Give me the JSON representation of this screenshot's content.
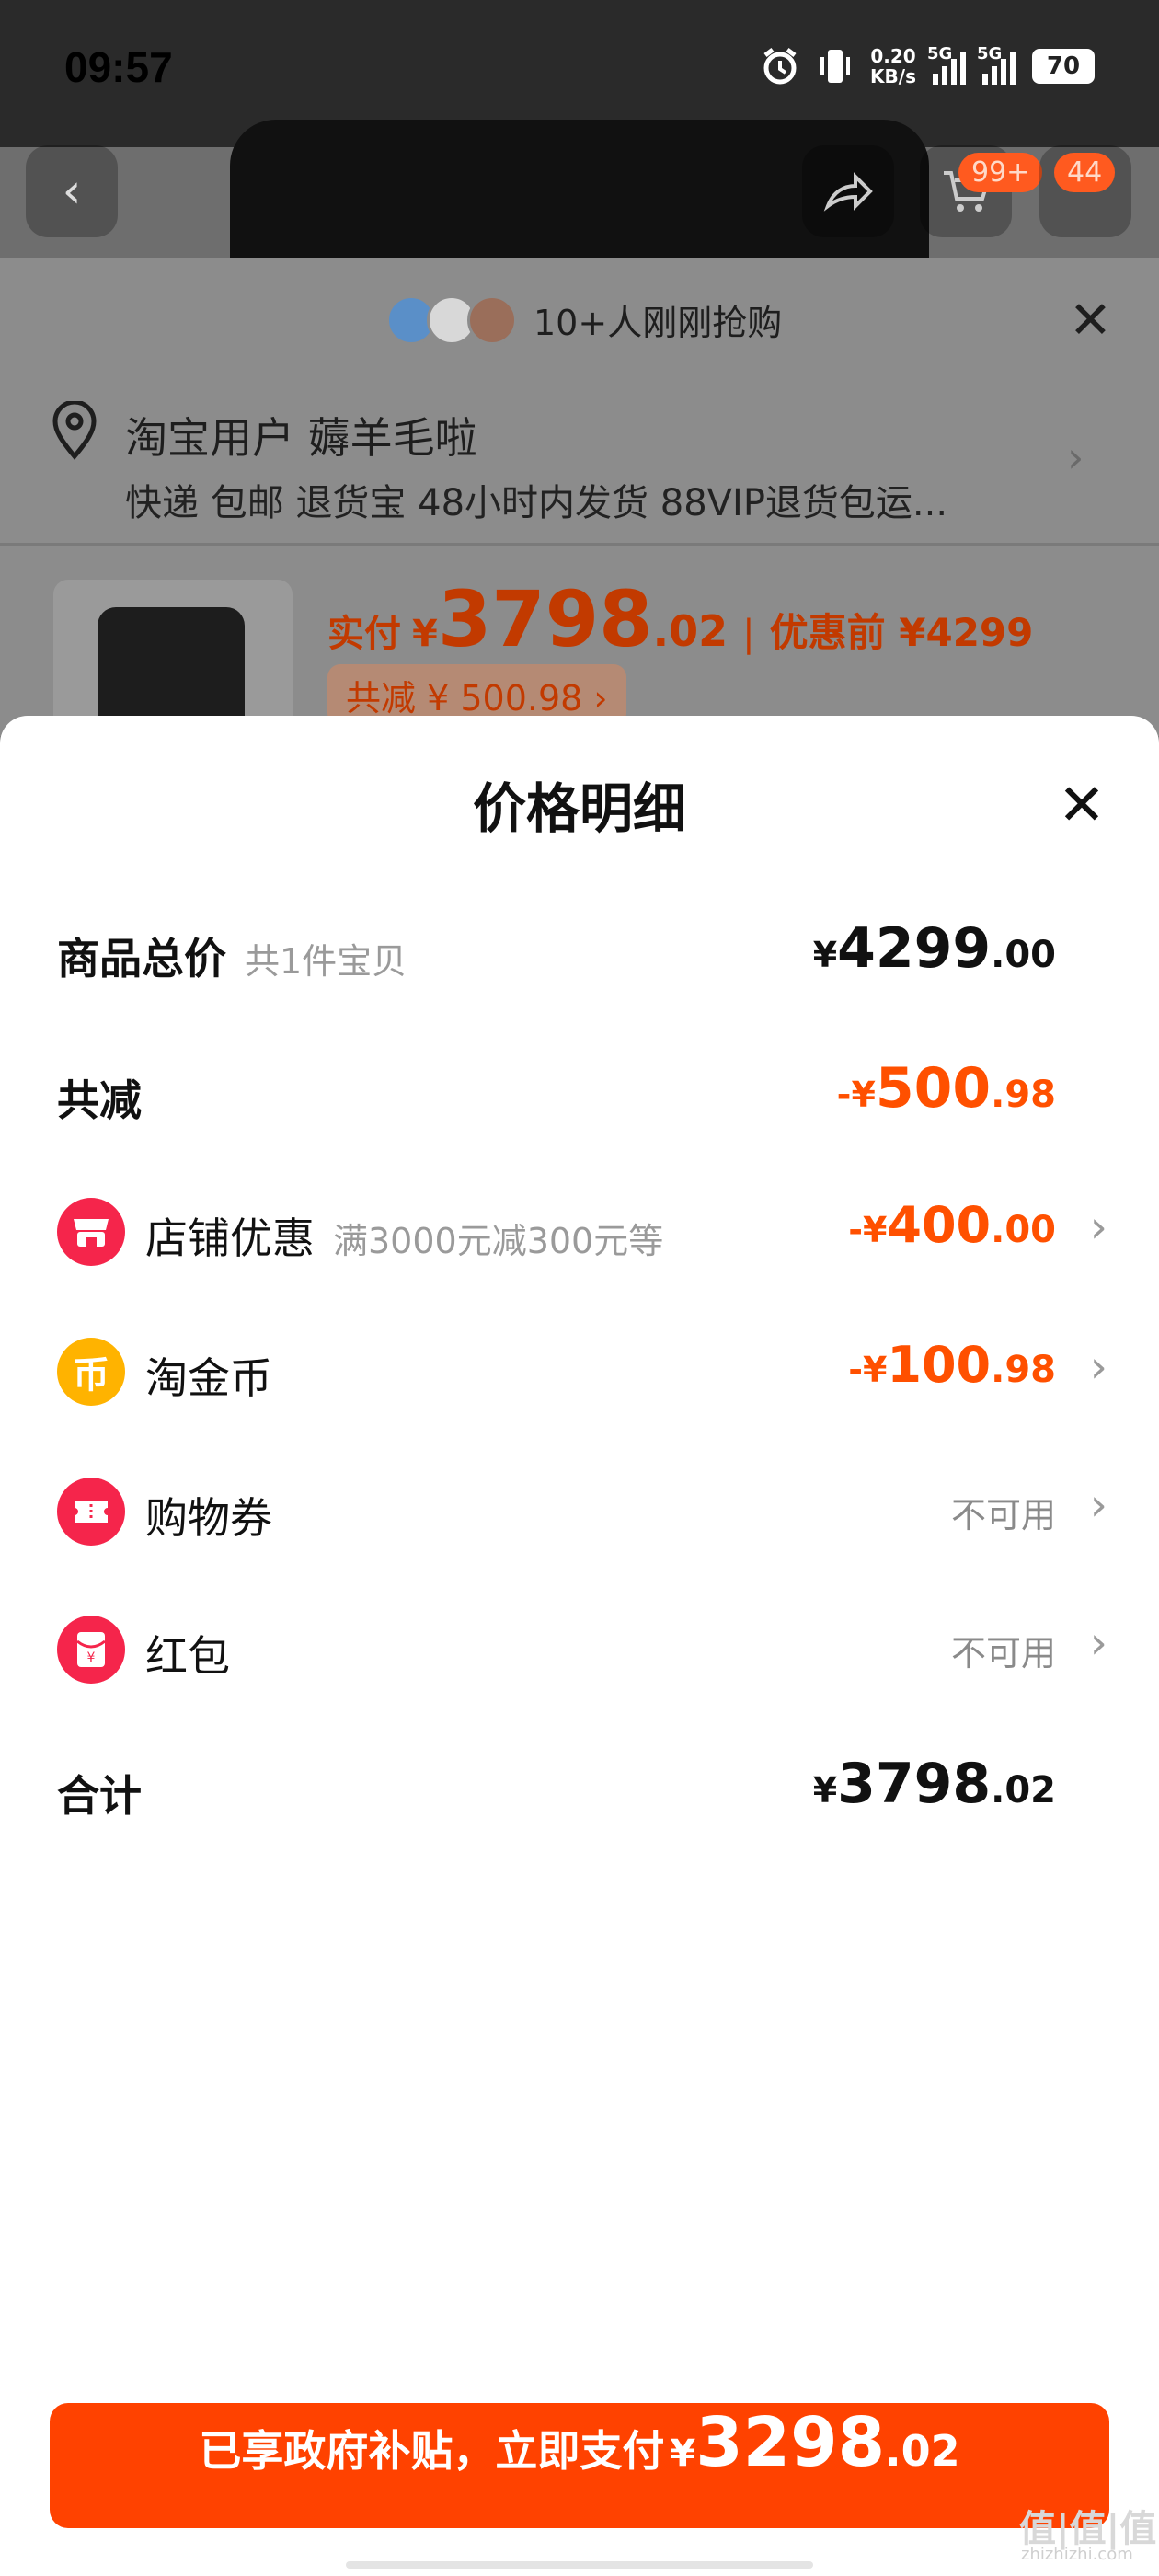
{
  "status_bar": {
    "time": "09:57",
    "net_speed": "0.20",
    "net_unit": "KB/s",
    "sim1": "5G",
    "sim2": "5G",
    "battery": "70"
  },
  "top_nav": {
    "cart_badge": "99+",
    "msg_badge": "44"
  },
  "behind": {
    "buyers_text": "10+人刚刚抢购",
    "address_name": "淘宝用户 薅羊毛啦",
    "address_services": "快递 包邮 退货宝 48小时内发货 88VIP退货包运...",
    "paid_label": "实付",
    "paid_currency": "¥",
    "paid_int": "3798",
    "paid_dec": ".02",
    "separator": "|",
    "original_label": "优惠前 ¥4299",
    "saved_tag": "共减 ¥ 500.98 ›"
  },
  "sheet": {
    "title": "价格明细",
    "total": {
      "label": "商品总价",
      "sub": "共1件宝贝",
      "currency": "¥",
      "int": "4299",
      "dec": ".00"
    },
    "discount": {
      "label": "共减",
      "currency": "-¥",
      "int": "500",
      "dec": ".98"
    },
    "items": [
      {
        "label": "店铺优惠",
        "sub": "满3000元减300元等",
        "currency": "-¥",
        "int": "400",
        "dec": ".00",
        "icon": "store-icon",
        "color": "#f5254b"
      },
      {
        "label": "淘金币",
        "sub": "",
        "currency": "-¥",
        "int": "100",
        "dec": ".98",
        "icon": "coin-icon",
        "color": "#ffb300"
      },
      {
        "label": "购物券",
        "sub": "",
        "status": "不可用",
        "icon": "coupon-icon",
        "color": "#f5254b"
      },
      {
        "label": "红包",
        "sub": "",
        "status": "不可用",
        "icon": "red-envelope-icon",
        "color": "#f5254b"
      }
    ],
    "sum": {
      "label": "合计",
      "currency": "¥",
      "int": "3798",
      "dec": ".02"
    }
  },
  "pay_button": {
    "text": "已享政府补贴，立即支付",
    "currency": "¥",
    "int": "3298",
    "dec": ".02"
  },
  "watermark": {
    "text": "值|值|值",
    "sub": "zhizhizhi.com"
  },
  "colors": {
    "accent": "#ff5000",
    "pay_button": "#ff4200"
  }
}
